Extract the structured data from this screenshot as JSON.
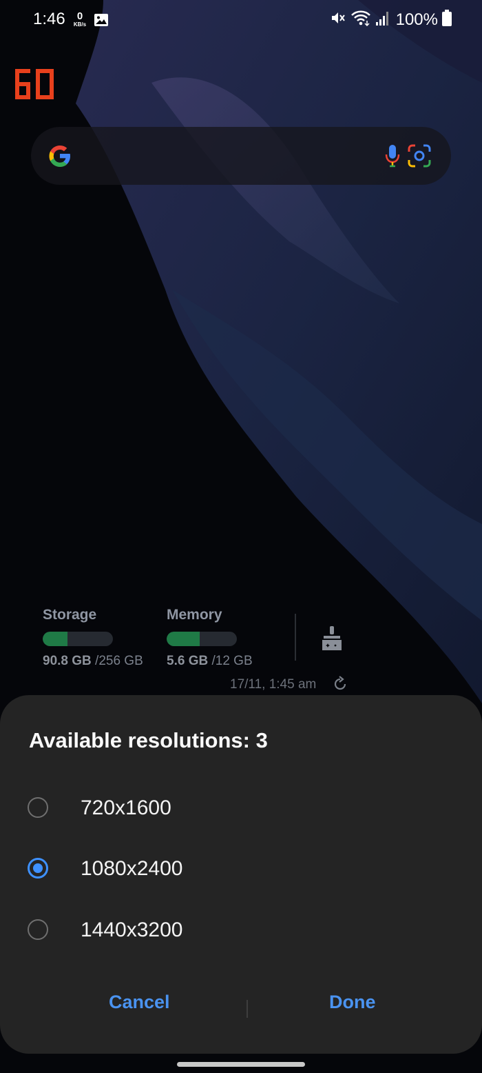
{
  "status_bar": {
    "time": "1:46",
    "net_speed_value": "0",
    "net_speed_unit": "KB/s",
    "battery": "100%",
    "icons": [
      "gallery-icon",
      "mute-icon",
      "wifi-icon",
      "signal-icon",
      "battery-icon"
    ]
  },
  "fps_counter": "60",
  "search_bar": {
    "icons": [
      "google-g-icon",
      "mic-icon",
      "lens-icon"
    ]
  },
  "device_care": {
    "storage": {
      "label": "Storage",
      "used": "90.8 GB",
      "total": " /256 GB",
      "fraction": 0.355
    },
    "memory": {
      "label": "Memory",
      "used": "5.6 GB",
      "total": " /12 GB",
      "fraction": 0.47
    },
    "last_updated": "17/11, 1:45 am"
  },
  "dialog": {
    "title": "Available resolutions: 3",
    "options": [
      {
        "label": "720x1600",
        "selected": false
      },
      {
        "label": "1080x2400",
        "selected": true
      },
      {
        "label": "1440x3200",
        "selected": false
      }
    ],
    "cancel_label": "Cancel",
    "done_label": "Done"
  },
  "colors": {
    "accent": "#3e91ff",
    "button_text": "#4a93f0",
    "dialog_bg": "#242424",
    "fps": "#e8401c",
    "bar_fill": "#1f7a46"
  }
}
